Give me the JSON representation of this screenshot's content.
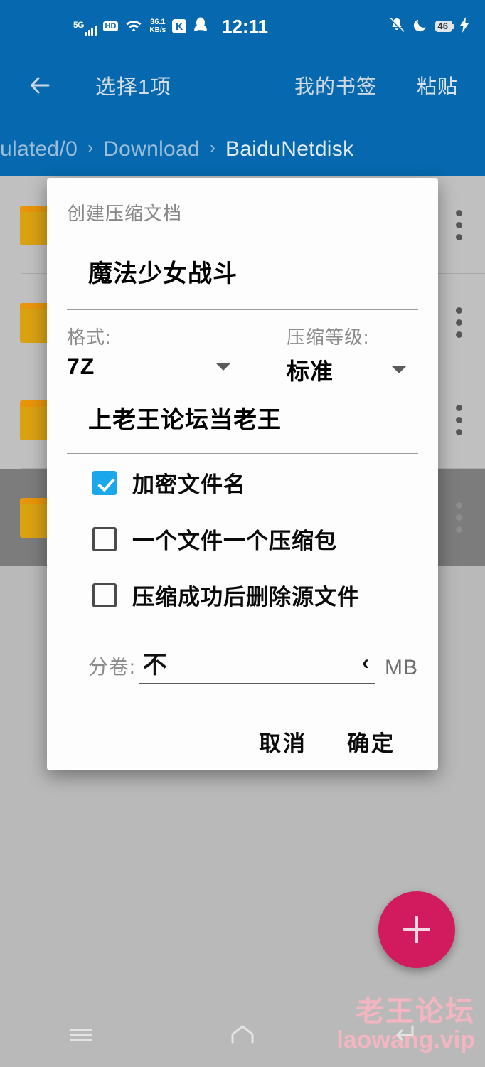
{
  "statusbar": {
    "network_label": "5G",
    "hd_label": "HD",
    "speed_value": "36.1",
    "speed_unit": "KB/s",
    "kuaishou_label": "K",
    "qq_icon": "qq-penguin-icon",
    "wifi_icon": "wifi-icon",
    "time": "12:11",
    "mute_icon": "bell-muted-icon",
    "dnd_icon": "moon-icon",
    "battery_percent": "46",
    "charging_icon": "lightning-bolt-icon"
  },
  "toolbar": {
    "back_icon": "back-arrow-icon",
    "title": "选择1项",
    "action_bookmarks": "我的书签",
    "action_paste": "粘贴"
  },
  "breadcrumb": {
    "separator": "›",
    "items": [
      {
        "label": "ulated/0",
        "current": false
      },
      {
        "label": "Download",
        "current": false
      },
      {
        "label": "BaiduNetdisk",
        "current": true
      }
    ]
  },
  "filelist": {
    "rows": [
      {
        "name": "",
        "selected": false
      },
      {
        "name": "",
        "selected": false
      },
      {
        "name": "",
        "selected": false
      },
      {
        "name": "",
        "selected": true
      }
    ],
    "folder_icon": "folder-icon",
    "overflow_icon": "more-vertical-icon"
  },
  "fab": {
    "icon": "plus-icon",
    "color": "#d11b5e"
  },
  "navbar": {
    "recents_icon": "menu-hamburger-icon",
    "home_icon": "home-icon",
    "back_icon": "back-nav-icon"
  },
  "watermark": {
    "cn": "老王论坛",
    "en": "laowang.vip",
    "color": "#f3b6c0"
  },
  "dialog": {
    "title": "创建压缩文档",
    "archive_name": "魔法少女战斗",
    "format": {
      "label": "格式:",
      "value": "7Z",
      "caret_icon": "chevron-down-icon"
    },
    "level": {
      "label": "压缩等级:",
      "value": "标准",
      "caret_icon": "chevron-down-icon"
    },
    "password": "上老王论坛当老王",
    "checkboxes": [
      {
        "label": "加密文件名",
        "checked": true
      },
      {
        "label": "一个文件一个压缩包",
        "checked": false
      },
      {
        "label": "压缩成功后删除源文件",
        "checked": false
      }
    ],
    "split": {
      "label": "分卷:",
      "value": "不",
      "chevron_icon": "chevron-left-icon",
      "unit": "MB"
    },
    "cancel_label": "取消",
    "confirm_label": "确定",
    "accent_color": "#1ba7ec"
  },
  "colors": {
    "appbar_blue": "#0668ae",
    "background_gray": "#c0c0c0",
    "selected_gray": "#7c7c7c",
    "folder_amber": "#d9a213"
  }
}
